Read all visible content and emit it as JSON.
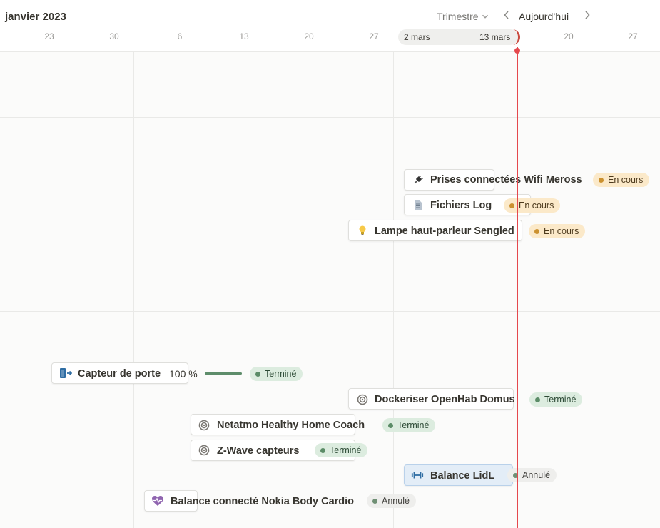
{
  "header": {
    "month": "janvier 2023",
    "period_label": "Trimestre",
    "today_label": "Aujourd’hui",
    "prev_icon": "chevron-left-icon",
    "next_icon": "chevron-right-icon"
  },
  "timeline": {
    "dates": [
      "23",
      "30",
      "6",
      "13",
      "20",
      "27",
      "20",
      "27"
    ],
    "range_start": "2 mars",
    "range_end": "13 mars",
    "accent": "#e5484d"
  },
  "items": [
    {
      "title": "Prises connectées Wifi Meross",
      "icon": "plug-icon",
      "status": "En cours"
    },
    {
      "title": "Fichiers Log",
      "icon": "document-icon",
      "status": "En cours"
    },
    {
      "title": "Lampe haut-parleur Sengled",
      "icon": "lightbulb-icon",
      "status": "En cours"
    },
    {
      "title": "Capteur de porte",
      "icon": "door-exit-icon",
      "progress": "100 %",
      "progress_value": 1.0,
      "status": "Terminé"
    },
    {
      "title": "Dockeriser OpenHab Domus",
      "icon": "target-icon",
      "status": "Terminé"
    },
    {
      "title": "Netatmo Healthy Home Coach",
      "icon": "target-icon",
      "status": "Terminé"
    },
    {
      "title": "Z-Wave capteurs",
      "icon": "target-icon",
      "status": "Terminé"
    },
    {
      "title": "Balance LidL",
      "icon": "dumbbell-icon",
      "status": "Annulé"
    },
    {
      "title": "Balance connecté Nokia Body Cardio",
      "icon": "heart-pulse-icon",
      "status": "Annulé"
    }
  ],
  "status_colors": {
    "En cours": "#cb912f",
    "Terminé": "#5b8c67",
    "Annulé": "#6f8f74"
  }
}
